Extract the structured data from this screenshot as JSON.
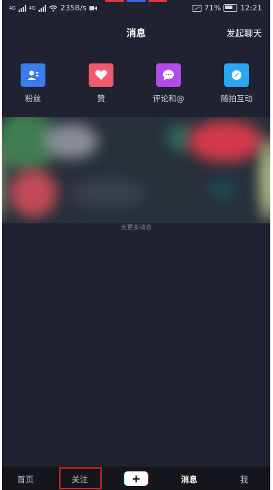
{
  "status_bar": {
    "network_1": "4G",
    "network_2": "4G",
    "speed": "235B/s",
    "battery": "71%",
    "time": "12:21"
  },
  "header": {
    "title": "消息",
    "start_chat": "发起聊天"
  },
  "quick_actions": [
    {
      "label": "粉丝",
      "icon": "fans-icon",
      "color": "#3a7bf0"
    },
    {
      "label": "赞",
      "icon": "heart-icon",
      "color": "#f15a6e"
    },
    {
      "label": "评论和@",
      "icon": "comment-icon",
      "color": "#b44be9"
    },
    {
      "label": "随拍互动",
      "icon": "camera-icon",
      "color": "#2aa6f5"
    }
  ],
  "messages": {
    "end_text": "无更多消息"
  },
  "bottom_nav": {
    "home": "首页",
    "follow": "关注",
    "add": "+",
    "messages": "消息",
    "me": "我"
  },
  "colors": {
    "background": "#202231",
    "nav_background": "#15151c",
    "highlight": "#d3231e"
  }
}
